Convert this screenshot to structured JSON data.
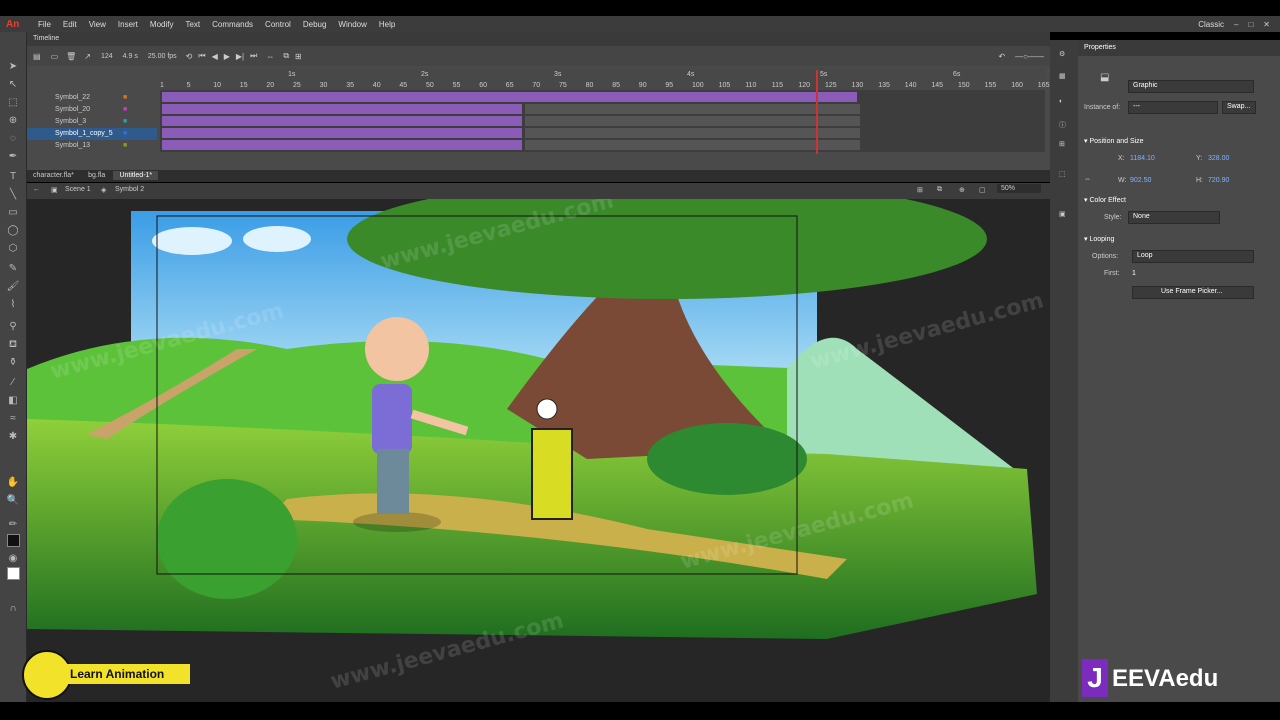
{
  "menu": {
    "app_logo": "An",
    "items": [
      "File",
      "Edit",
      "View",
      "Insert",
      "Modify",
      "Text",
      "Commands",
      "Control",
      "Debug",
      "Window",
      "Help"
    ],
    "workspace": "Classic"
  },
  "timeline": {
    "title": "Timeline",
    "fps_frame": "124",
    "time": "4.9 s",
    "fps": "25.00 fps",
    "seconds": [
      "1s",
      "2s",
      "3s",
      "4s",
      "5s",
      "6s"
    ],
    "frame_ticks": [
      "1",
      "5",
      "10",
      "15",
      "20",
      "25",
      "30",
      "35",
      "40",
      "45",
      "50",
      "55",
      "60",
      "65",
      "70",
      "75",
      "80",
      "85",
      "90",
      "95",
      "100",
      "105",
      "110",
      "115",
      "120",
      "125",
      "130",
      "135",
      "140",
      "145",
      "150",
      "155",
      "160",
      "165"
    ],
    "layers": [
      "Symbol_22",
      "Symbol_20",
      "Symbol_3",
      "Symbol_1_copy_5",
      "Symbol_13"
    ],
    "selected_layer": "Symbol_1_copy_5"
  },
  "tabs": [
    "character.fla*",
    "bg.fla",
    "Untitled-1*"
  ],
  "active_tab": "Untitled-1*",
  "breadcrumb": {
    "scene": "Scene 1",
    "symbol": "Symbol 2"
  },
  "zoom": "50%",
  "properties": {
    "title": "Properties",
    "type": "Graphic",
    "instance_of_label": "Instance of:",
    "instance_of_value": "---",
    "swap": "Swap...",
    "position_section": "Position and Size",
    "x_label": "X:",
    "x": "1184.10",
    "y_label": "Y:",
    "y": "328.00",
    "w_label": "W:",
    "w": "902.50",
    "h_label": "H:",
    "h": "720.90",
    "color_section": "Color Effect",
    "style_label": "Style:",
    "style": "None",
    "looping_section": "Looping",
    "options_label": "Options:",
    "options": "Loop",
    "first_label": "First:",
    "first": "1",
    "frame_picker": "Use Frame Picker..."
  },
  "overlay": {
    "learn": "Learn Animation",
    "brand": "EEVAedu",
    "watermark": "www.jeevaedu.com"
  },
  "colors": {
    "accent": "#8a5cb8",
    "brand_purple": "#7b2cbf",
    "playhead": "#cc3333"
  }
}
